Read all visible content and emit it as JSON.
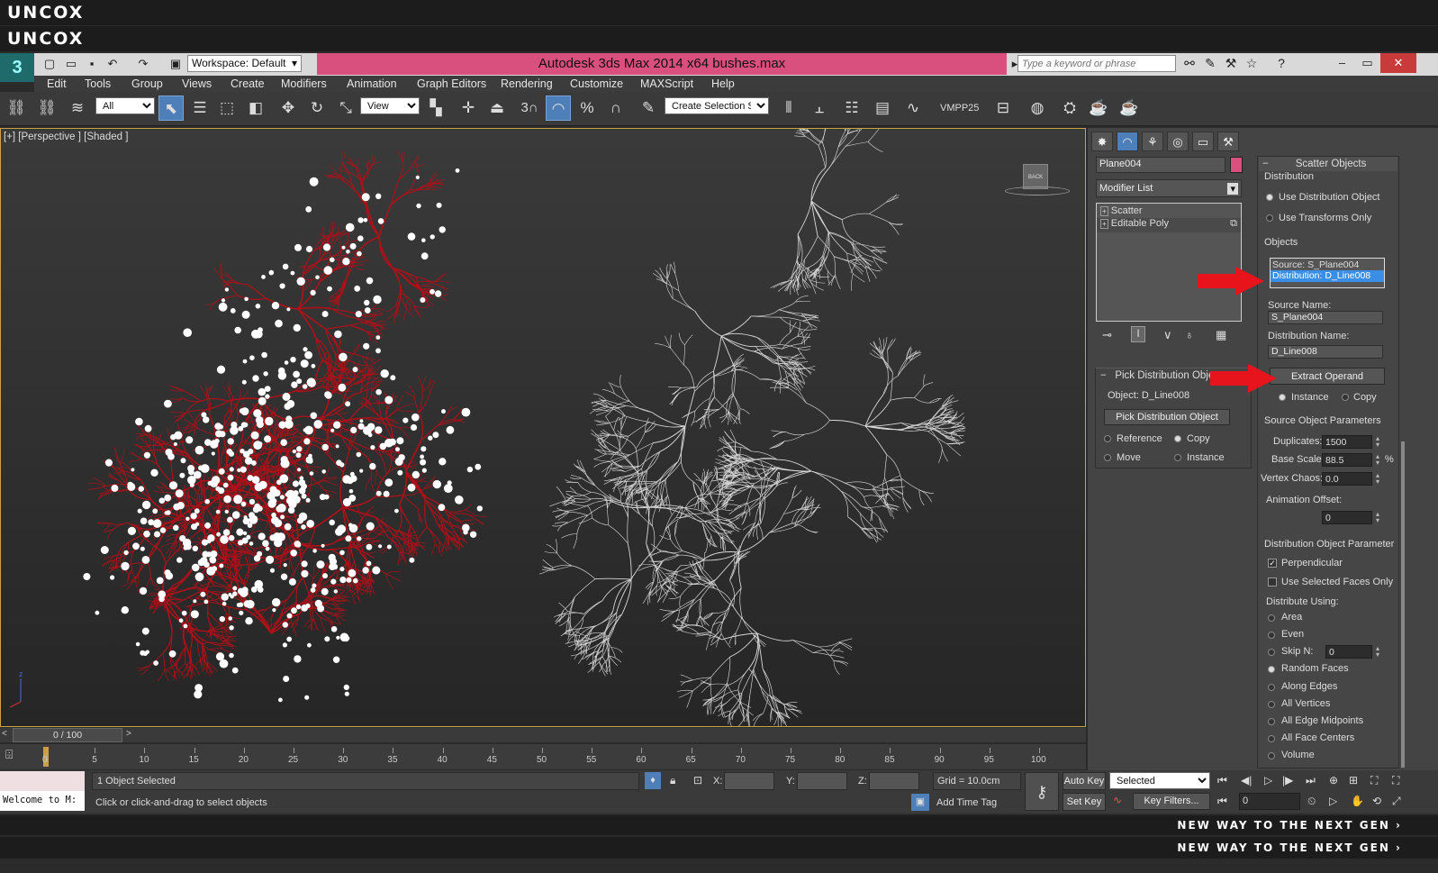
{
  "banner": {
    "logo": "UNCOX",
    "tagline": "NEW WAY TO THE NEXT GEN ›"
  },
  "titlebar": {
    "workspace": "Workspace: Default",
    "title": "Autodesk 3ds Max  2014 x64      bushes.max",
    "search_placeholder": "Type a keyword or phrase"
  },
  "menu": [
    "Edit",
    "Tools",
    "Group",
    "Views",
    "Create",
    "Modifiers",
    "Animation",
    "Graph Editors",
    "Rendering",
    "Customize",
    "MAXScript",
    "Help"
  ],
  "toolbar": {
    "filter": "All",
    "ref_coord": "View",
    "selection_set": "Create Selection Se",
    "snap_label": "3",
    "vmpp": "VMPP25"
  },
  "viewport": {
    "label": "[+] [Perspective ] [Shaded ]",
    "viewcube": "BACK"
  },
  "modify": {
    "object_name": "Plane004",
    "modifier_list": "Modifier List",
    "stack": [
      "Scatter",
      "Editable Poly"
    ],
    "pick_title": "Pick Distribution Object",
    "object": "Object: D_Line008",
    "pick_button": "Pick Distribution Object",
    "opts": [
      "Reference",
      "Copy",
      "Move",
      "Instance"
    ]
  },
  "scatter": {
    "title": "Scatter Objects",
    "distribution_group": "Distribution",
    "use_dist": "Use Distribution Object",
    "use_transforms": "Use Transforms Only",
    "objects_group": "Objects",
    "objects_list": [
      "Source: S_Plane004",
      "Distribution: D_Line008"
    ],
    "source_name_label": "Source Name:",
    "source_name": "S_Plane004",
    "dist_name_label": "Distribution Name:",
    "dist_name": "D_Line008",
    "extract": "Extract Operand",
    "instance": "Instance",
    "copy": "Copy",
    "source_params": "Source Object Parameters",
    "duplicates_label": "Duplicates:",
    "duplicates": "1500",
    "base_scale_label": "Base Scale:",
    "base_scale": "88.5",
    "percent": "%",
    "vertex_chaos_label": "Vertex Chaos:",
    "vertex_chaos": "0.0",
    "anim_offset_label": "Animation Offset:",
    "anim_offset": "0",
    "dist_params": "Distribution Object Parameter",
    "perpendicular": "Perpendicular",
    "use_selected": "Use Selected Faces Only",
    "distribute_using": "Distribute Using:",
    "options": [
      "Area",
      "Even",
      "Skip N:",
      "Random Faces",
      "Along Edges",
      "All Vertices",
      "All Edge Midpoints",
      "All Face Centers",
      "Volume"
    ],
    "skip_n": "0"
  },
  "timeline": {
    "frame": "0 / 100",
    "ticks": [
      "0",
      "5",
      "10",
      "15",
      "20",
      "25",
      "30",
      "35",
      "40",
      "45",
      "50",
      "55",
      "60",
      "65",
      "70",
      "75",
      "80",
      "85",
      "90",
      "95",
      "100"
    ]
  },
  "status": {
    "maxscript": "Welcome to M:",
    "selected": "1 Object Selected",
    "prompt": "Click or click-and-drag to select objects",
    "x": "X:",
    "y": "Y:",
    "z": "Z:",
    "grid": "Grid = 10.0cm",
    "add_time_tag": "Add Time Tag",
    "auto_key": "Auto Key",
    "set_key": "Set Key",
    "key_mode": "Selected",
    "key_filters": "Key Filters...",
    "frame_field": "0"
  },
  "colors": {
    "accent": "#d94f7d",
    "red_bush": "#b01018",
    "arrow": "#e8141c",
    "highlight": "#3a8ee6"
  }
}
